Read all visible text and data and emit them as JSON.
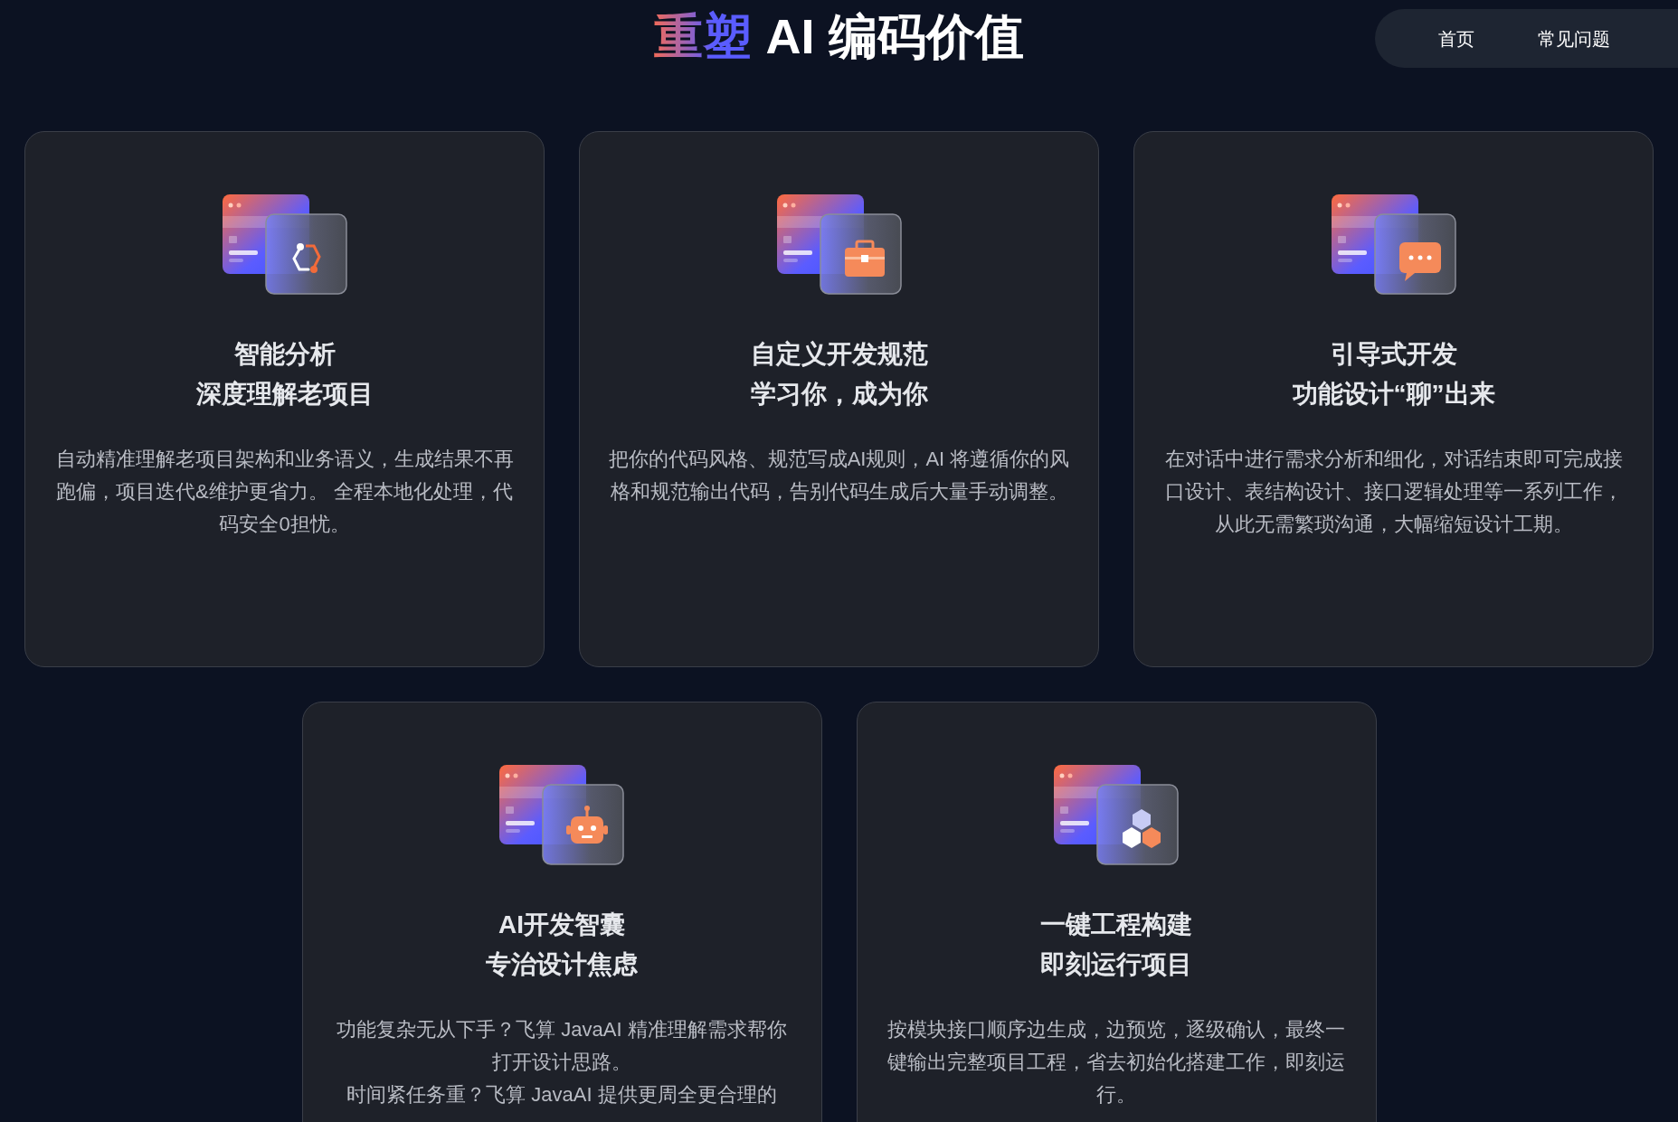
{
  "header": {
    "title_accent": "重塑",
    "title": "AI 编码价值",
    "nav": [
      {
        "label": "首页"
      },
      {
        "label": "常见问题"
      }
    ]
  },
  "cards": [
    {
      "title": [
        "智能分析",
        "深度理解老项目"
      ],
      "description": [
        "自动精准理解老项目架构和业务语义，生成结果不再跑偏，项目迭代&维护更省力。 全程本地化处理，代码安全0担忧。"
      ]
    },
    {
      "title": [
        "自定义开发规范",
        "学习你，成为你"
      ],
      "description": [
        "把你的代码风格、规范写成AI规则，AI 将遵循你的风格和规范输出代码，告别代码生成后大量手动调整。"
      ]
    },
    {
      "title": [
        "引导式开发",
        "功能设计“聊”出来"
      ],
      "description": [
        "在对话中进行需求分析和细化，对话结束即可完成接口设计、表结构设计、接口逻辑处理等一系列工作，从此无需繁琐沟通，大幅缩短设计工期。"
      ]
    },
    {
      "title": [
        "AI开发智囊",
        "专治设计焦虑"
      ],
      "description": [
        "功能复杂无从下手？飞算 JavaAI 精准理解需求帮你打开设计思路。",
        "时间紧任务重？飞算 JavaAI 提供更周全更合理的"
      ]
    },
    {
      "title": [
        "一键工程构建",
        "即刻运行项目"
      ],
      "description": [
        "按模块接口顺序边生成，边预览，逐级确认，最终一键输出完整项目工程，省去初始化搭建工作，即刻运行。"
      ]
    }
  ]
}
